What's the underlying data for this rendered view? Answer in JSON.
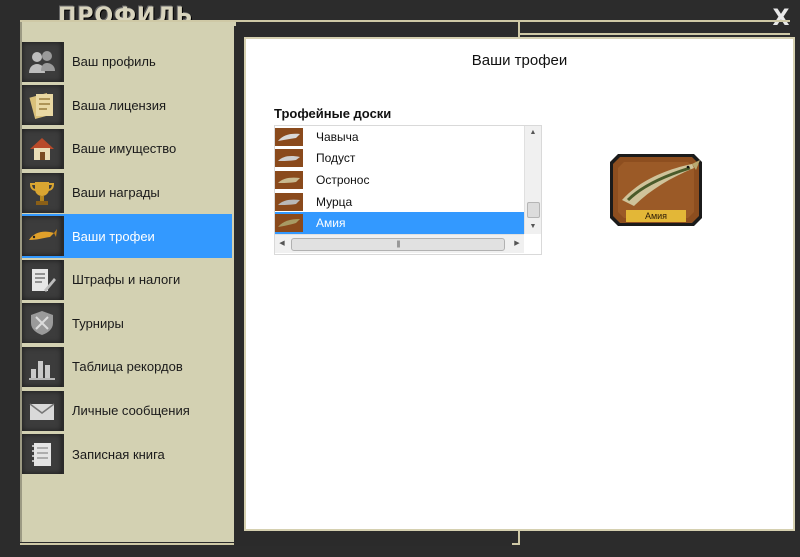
{
  "window": {
    "title": "ПРОФИЛЬ",
    "close_label": "X"
  },
  "sidebar": {
    "items": [
      {
        "label": "Ваш профиль",
        "icon": "users-icon",
        "active": false
      },
      {
        "label": "Ваша лицензия",
        "icon": "license-icon",
        "active": false
      },
      {
        "label": "Ваше имущество",
        "icon": "house-icon",
        "active": false
      },
      {
        "label": "Ваши награды",
        "icon": "trophy-cup-icon",
        "active": false
      },
      {
        "label": "Ваши трофеи",
        "icon": "fish-trophy-icon",
        "active": true
      },
      {
        "label": "Штрафы и налоги",
        "icon": "document-pen-icon",
        "active": false
      },
      {
        "label": "Турниры",
        "icon": "shield-icon",
        "active": false
      },
      {
        "label": "Таблица рекордов",
        "icon": "bar-chart-icon",
        "active": false
      },
      {
        "label": "Личные сообщения",
        "icon": "envelope-icon",
        "active": false
      },
      {
        "label": "Записная книга",
        "icon": "notebook-icon",
        "active": false
      }
    ]
  },
  "main": {
    "title": "Ваши трофеи",
    "section_label": "Трофейные доски",
    "trophy_list": [
      {
        "label": "Чавыча",
        "selected": false
      },
      {
        "label": "Подуст",
        "selected": false
      },
      {
        "label": "Остронос",
        "selected": false
      },
      {
        "label": "Мурца",
        "selected": false
      },
      {
        "label": "Амия",
        "selected": true
      }
    ],
    "preview": {
      "caption": "Амия"
    }
  },
  "colors": {
    "accent": "#3399ff",
    "sidebar_bg": "#d3d1b2",
    "frame_bg": "#2c2c2c",
    "wood": "#8a4a1c",
    "plaque": "#e3b737"
  }
}
